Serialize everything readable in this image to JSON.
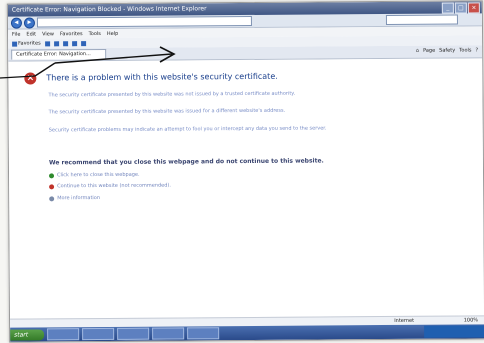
{
  "window": {
    "title": "Certificate Error: Navigation Blocked - Windows Internet Explorer",
    "address_text": "",
    "minimize": "_",
    "maximize": "□",
    "close": "×"
  },
  "menubar": {
    "items": [
      "File",
      "Edit",
      "View",
      "Favorites",
      "Tools",
      "Help"
    ]
  },
  "favorites": {
    "label": "Favorites"
  },
  "tab": {
    "label": "Certificate Error: Navigation..."
  },
  "commands": {
    "page": "Page",
    "safety": "Safety",
    "tools": "Tools"
  },
  "content": {
    "heading": "There is a problem with this website's security certificate.",
    "p1": "The security certificate presented by this website was not issued by a trusted certificate authority.",
    "p2": "The security certificate presented by this website was issued for a different website's address.",
    "p3": "Security certificate problems may indicate an attempt to fool you or intercept any data you send to the server.",
    "recommend": "We recommend that you close this webpage and do not continue to this website.",
    "options": [
      "Click here to close this webpage.",
      "Continue to this website (not recommended).",
      "More information"
    ]
  },
  "statusbar": {
    "zone": "Internet",
    "zoom": "100%"
  },
  "taskbar": {
    "start": "start"
  },
  "colors": {
    "heading": "#1a3f8c",
    "link": "#7487be",
    "shield": "#c0332b",
    "taskbar": "#2a4a8a",
    "arrow": "#111111"
  }
}
